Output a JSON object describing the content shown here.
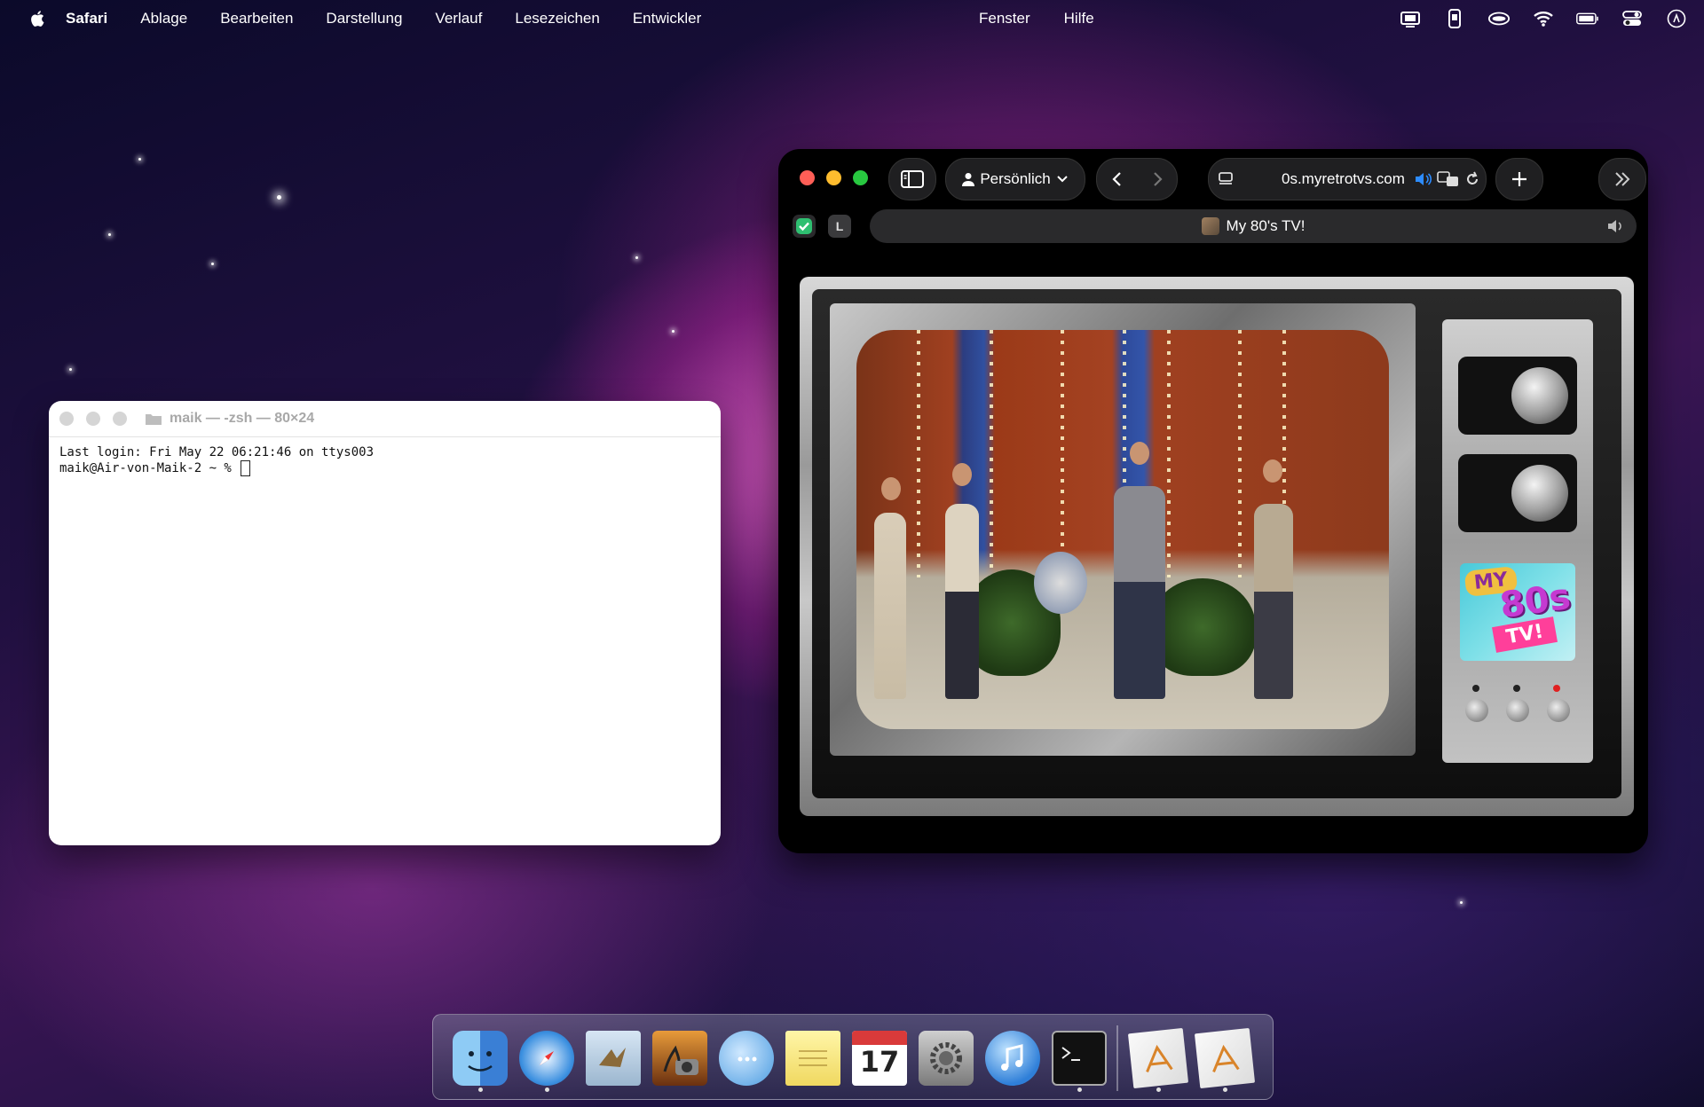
{
  "menubar": {
    "app_name": "Safari",
    "items": [
      "Ablage",
      "Bearbeiten",
      "Darstellung",
      "Verlauf",
      "Lesezeichen",
      "Entwickler"
    ],
    "items_right": [
      "Fenster",
      "Hilfe"
    ],
    "status_icons": [
      "screen-mirroring-icon",
      "phone-icon",
      "vision-icon",
      "wifi-icon",
      "battery-icon",
      "control-center-icon",
      "user-icon"
    ]
  },
  "terminal": {
    "title": "maik — -zsh — 80×24",
    "line1": "Last login: Fri May 22 06:21:46 on ttys003",
    "line2": "maik@Air-von-Maik-2 ~ % "
  },
  "safari": {
    "profile_label": "Persönlich",
    "url": "0s.myretrotvs.com",
    "tab_title": "My 80's TV!",
    "extension_badge": "L"
  },
  "tv": {
    "logo_my": "MY",
    "logo_80s": "80s",
    "logo_tv": "TV!"
  },
  "dock": {
    "apps": [
      {
        "name": "finder-icon",
        "running": true
      },
      {
        "name": "safari-icon",
        "running": true
      },
      {
        "name": "mail-icon",
        "running": false
      },
      {
        "name": "iphoto-icon",
        "running": false
      },
      {
        "name": "ichat-icon",
        "running": false
      },
      {
        "name": "notes-icon",
        "running": false
      },
      {
        "name": "ical-icon",
        "running": false,
        "label": "17"
      },
      {
        "name": "system-preferences-icon",
        "running": false
      },
      {
        "name": "itunes-icon",
        "running": false
      },
      {
        "name": "terminal-icon",
        "running": true
      }
    ],
    "docs": [
      {
        "name": "document-icon-1",
        "running": true
      },
      {
        "name": "document-icon-2",
        "running": true
      }
    ]
  }
}
